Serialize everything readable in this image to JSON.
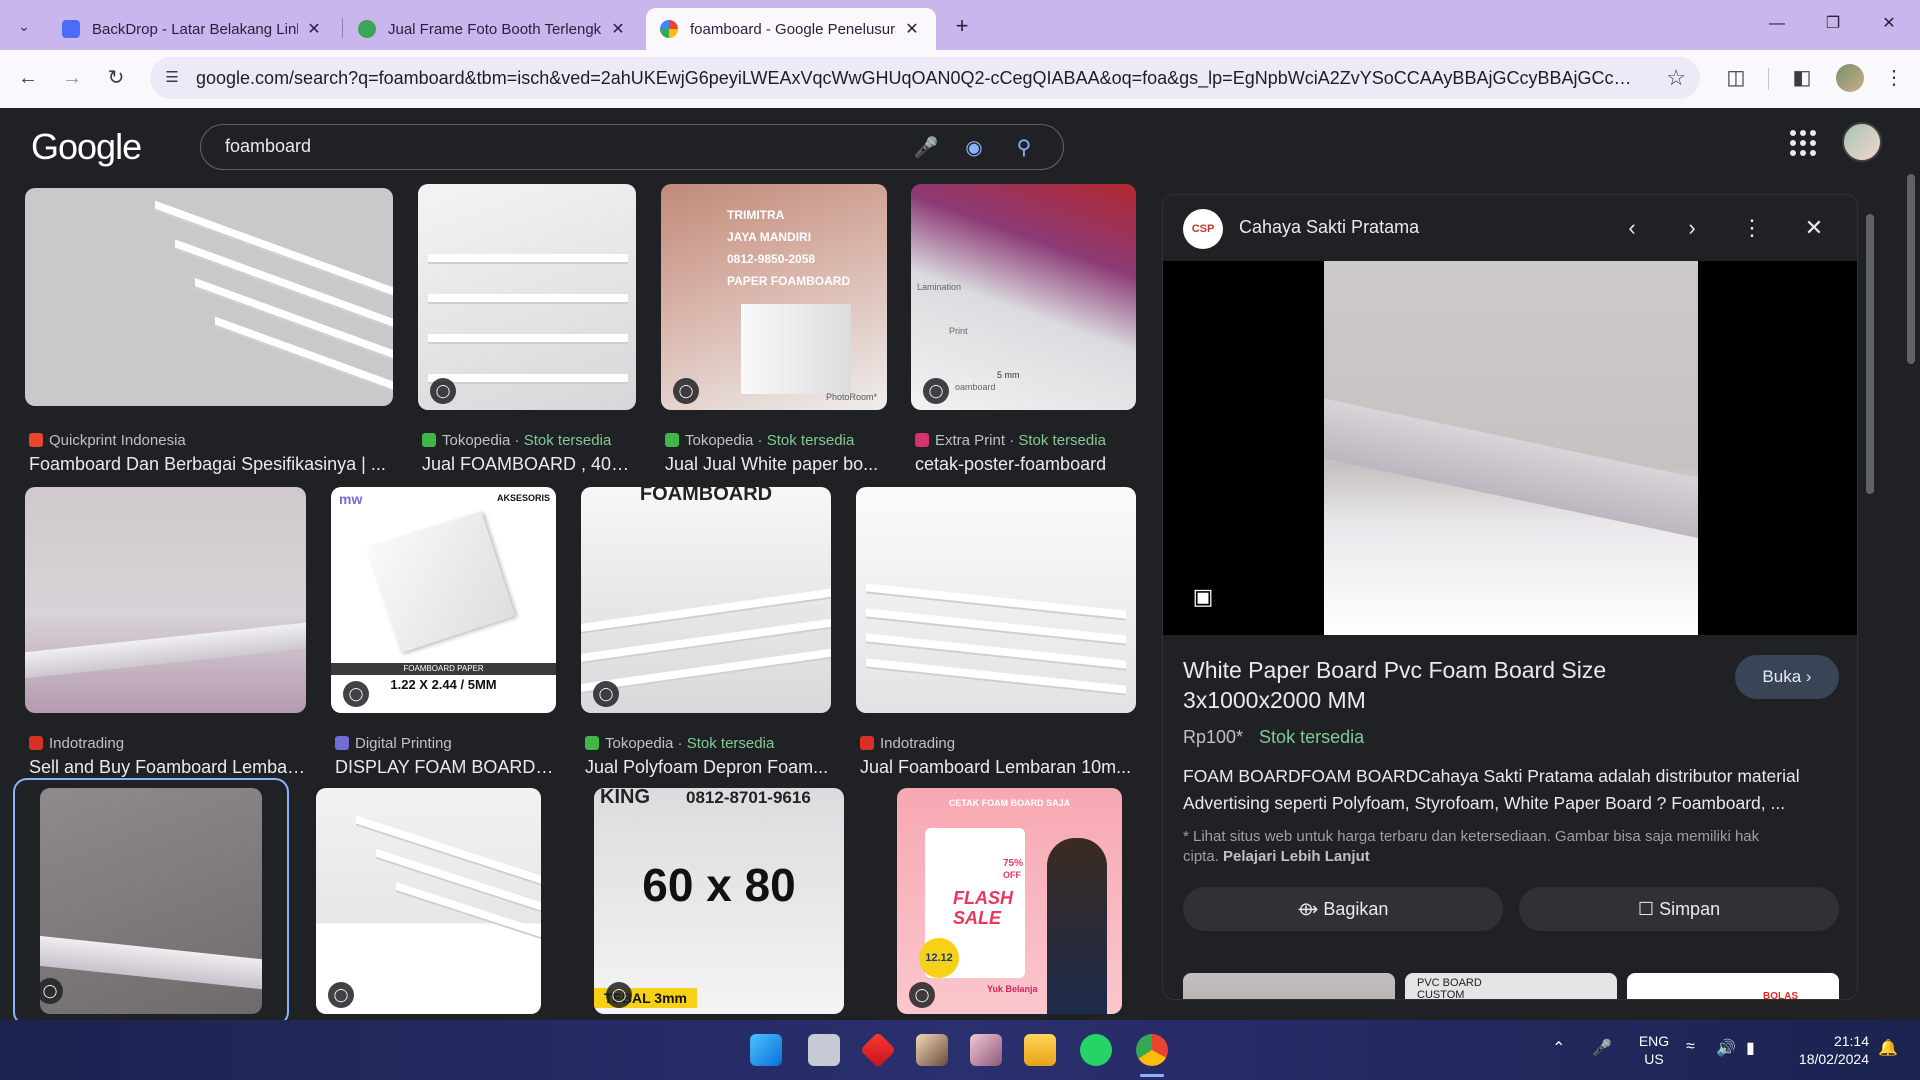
{
  "browser": {
    "tabs": [
      {
        "title": "BackDrop - Latar Belakang Link",
        "fav_color": "#4a6cf7",
        "active": false
      },
      {
        "title": "Jual Frame Foto Booth Terlengk",
        "fav_color": "#3aa657",
        "active": false
      },
      {
        "title": "foamboard - Google Penelusura",
        "fav_color": "#4285f4",
        "active": true
      }
    ],
    "url": "google.com/search?q=foamboard&tbm=isch&ved=2ahUKEwjG6peyiLWEAxVqcWwGHUqOAN0Q2-cCegQIABAA&oq=foa&gs_lp=EgNpbWciA2ZvYSoCCAAyBBAjGCcyBBAjGCcyCBAAGIAE..."
  },
  "google": {
    "logo": "Google",
    "query": "foamboard"
  },
  "results": [
    {
      "source": "Quickprint Indonesia",
      "stock": "",
      "caption": "Foamboard Dan Berbagai Spesifikasinya | ...",
      "fav": "#e8452c"
    },
    {
      "source": "Tokopedia",
      "stock": "Stok tersedia",
      "caption": "Jual FOAMBOARD , 40X...",
      "fav": "#42b549"
    },
    {
      "source": "Tokopedia",
      "stock": "Stok tersedia",
      "caption": "Jual Jual White paper bo...",
      "fav": "#42b549",
      "overlay": [
        "TRIMITRA",
        "JAYA MANDIRI",
        "0812-9850-2058",
        "PAPER FOAMBOARD"
      ],
      "brand": "PhotoRoom*"
    },
    {
      "source": "Extra Print",
      "stock": "Stok tersedia",
      "caption": "cetak-poster-foamboard",
      "fav": "#d6336c",
      "labels": [
        "Lamination",
        "Print",
        "5 mm",
        "oamboard"
      ]
    },
    {
      "source": "Indotrading",
      "stock": "",
      "caption": "Sell and Buy Foamboard Lembar...",
      "fav": "#d93025"
    },
    {
      "source": "Digital Printing",
      "stock": "",
      "caption": "DISPLAY FOAM BOARD 5...",
      "fav": "#6f6fd6",
      "labels": [
        "AKSESORIS",
        "FOAMBOARD PAPER",
        "1.22 X 2.44 / 5MM",
        "mw"
      ]
    },
    {
      "source": "Tokopedia",
      "stock": "Stok tersedia",
      "caption": "Jual Polyfoam Depron Foam...",
      "fav": "#42b549",
      "labels": [
        "FOAMBOARD"
      ]
    },
    {
      "source": "Indotrading",
      "stock": "",
      "caption": "Jual Foamboard Lembaran 10m...",
      "fav": "#d93025"
    },
    {
      "labels": [
        "KING",
        "0812-8701-9616",
        "60 x 80",
        "TEBAL 3mm"
      ]
    },
    {
      "labels": [
        "CETAK FOAM BOARD SAJA",
        "FLASH",
        "SALE",
        "75%",
        "OFF",
        "12.12",
        "Yuk Belanja"
      ]
    }
  ],
  "panel": {
    "site_name": "Cahaya Sakti Pratama",
    "logo_text": "CSP",
    "title": "White Paper Board Pvc Foam Board Size 3x1000x2000 MM",
    "open_label": "Buka",
    "price": "Rp100*",
    "stock": "Stok tersedia",
    "description": "FOAM BOARDFOAM BOARDCahaya Sakti Pratama adalah distributor material Advertising seperti Polyfoam, Styrofoam, White Paper Board ? Foamboard, ...",
    "note": "* Lihat situs web untuk harga terbaru dan ketersediaan. Gambar bisa saja memiliki hak cipta.",
    "learn_more": "Pelajari Lebih Lanjut",
    "share_label": "Bagikan",
    "save_label": "Simpan",
    "related_labels": [
      "PVC BOARD",
      "CUSTOM",
      "BOLAS"
    ]
  },
  "taskbar": {
    "lang_line1": "ENG",
    "lang_line2": "US",
    "time": "21:14",
    "date": "18/02/2024"
  }
}
